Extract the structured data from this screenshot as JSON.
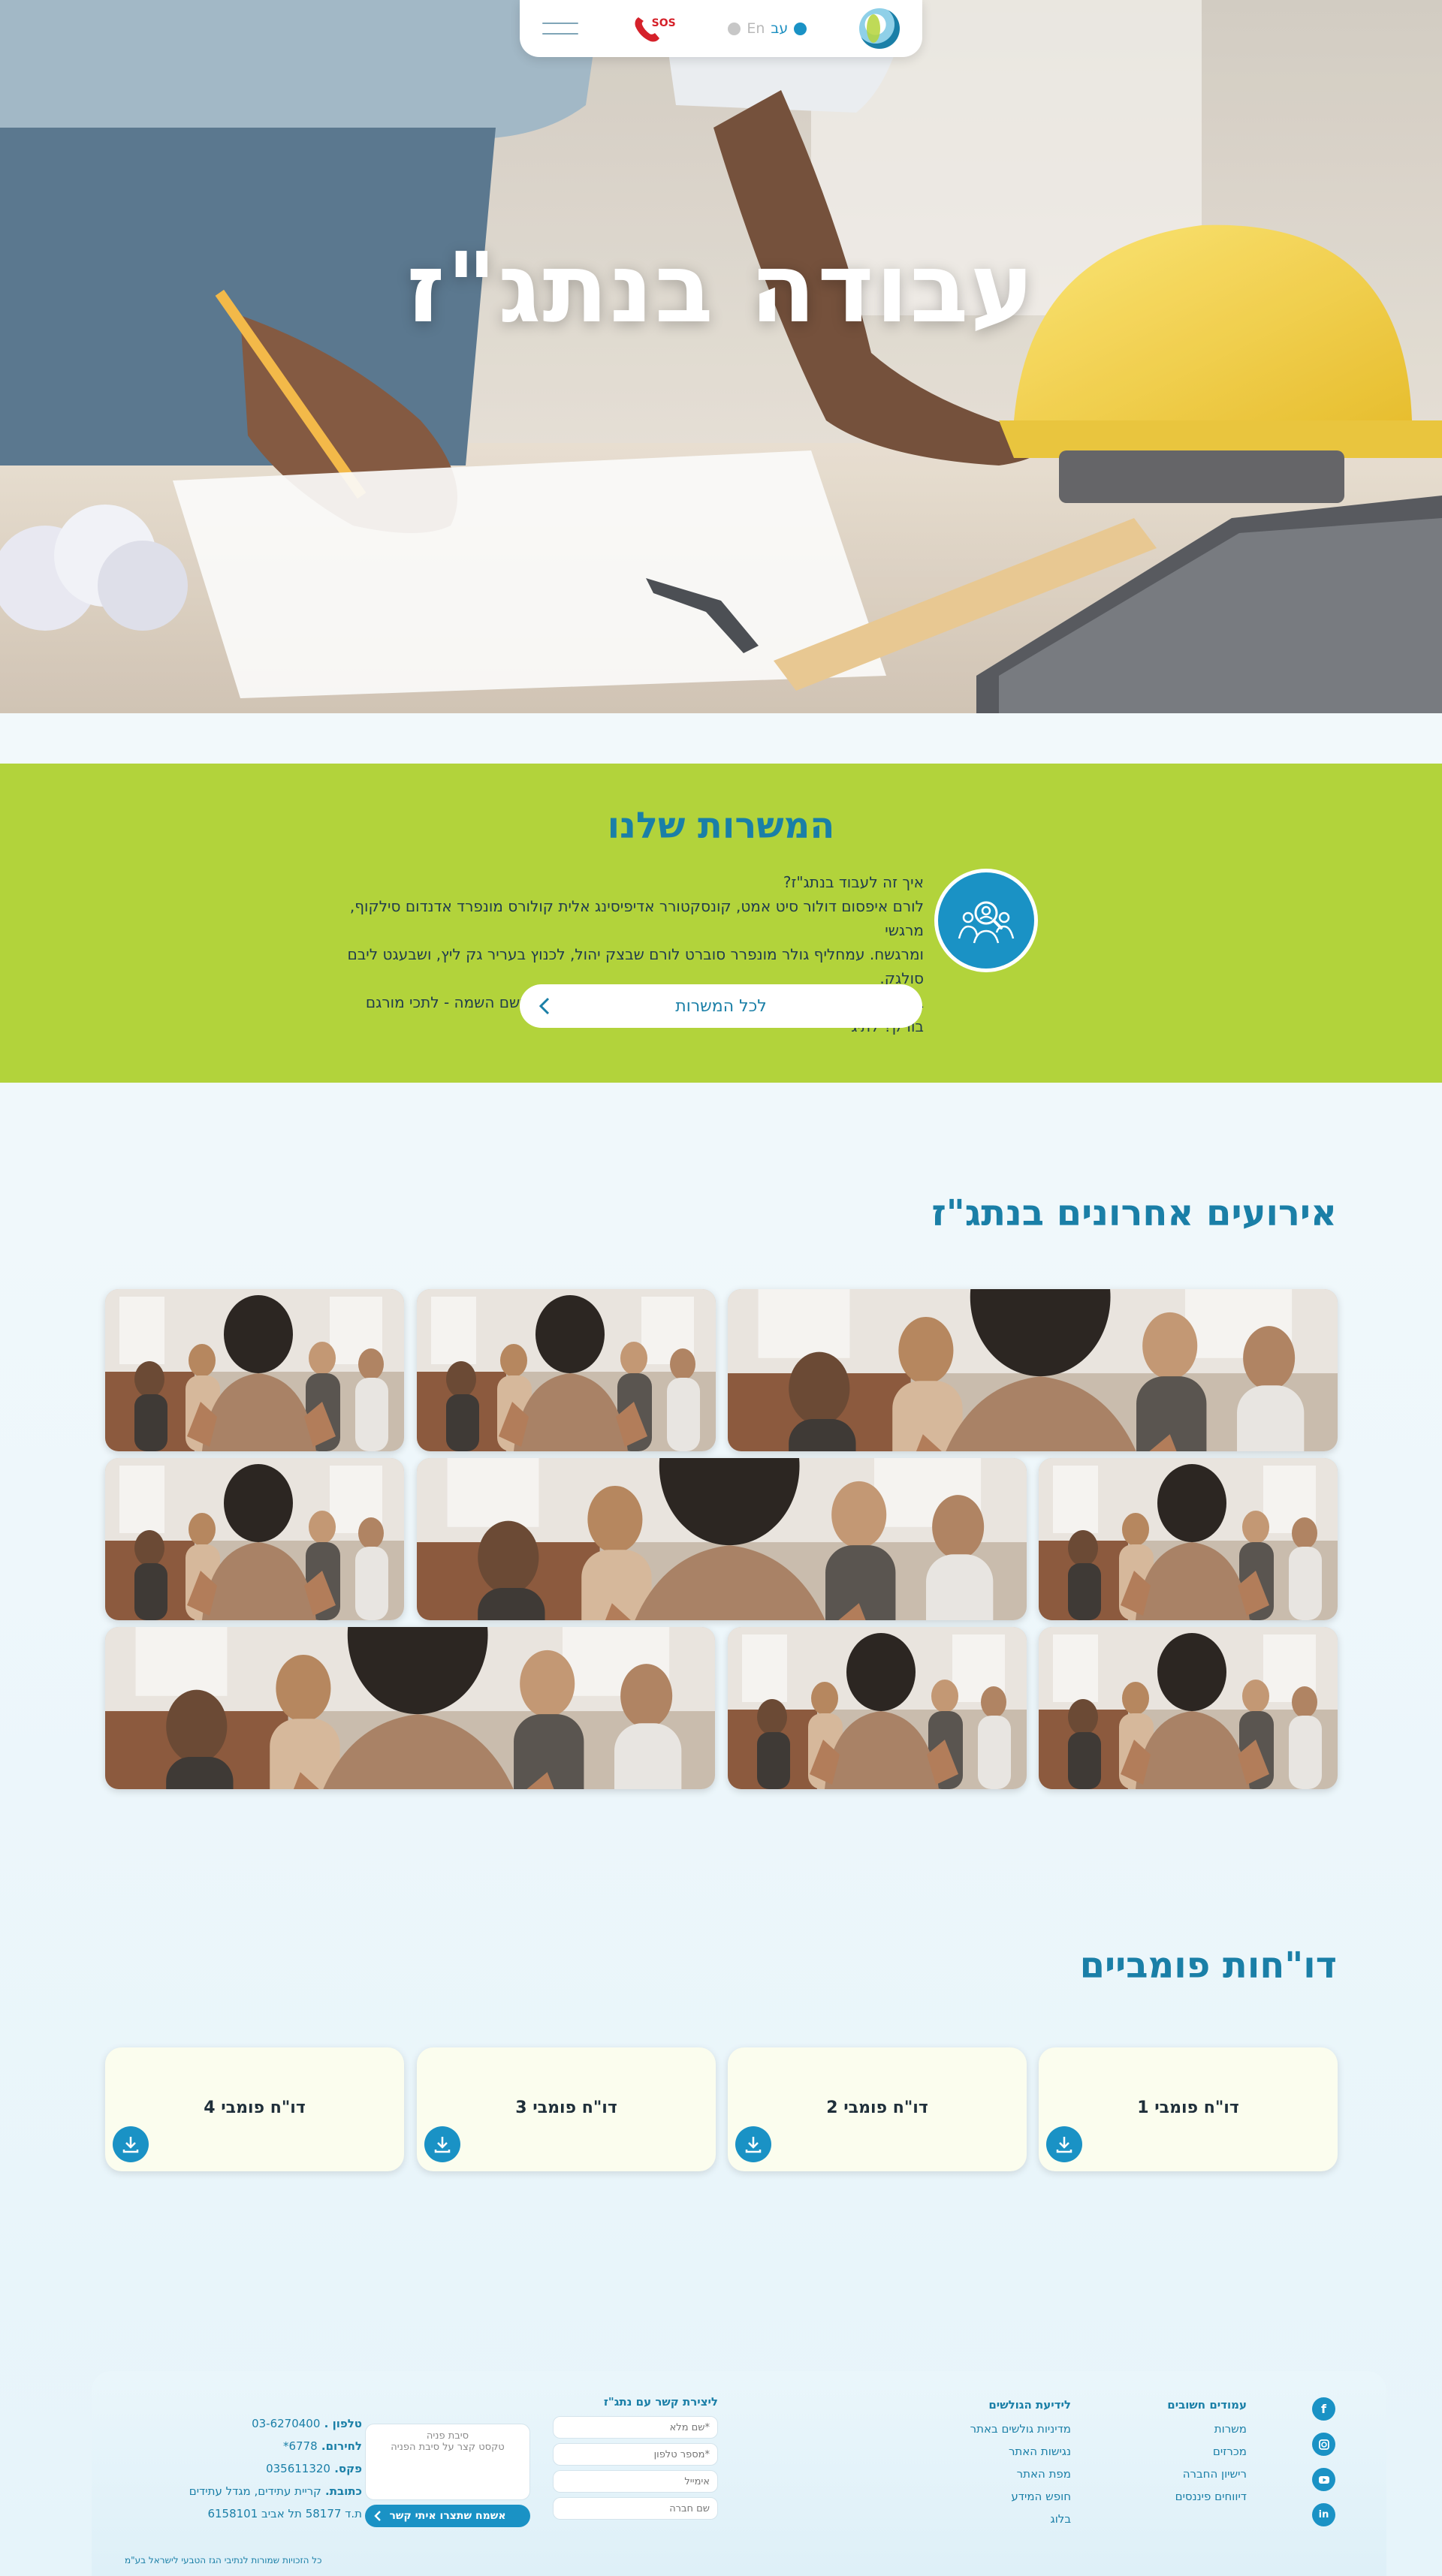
{
  "nav": {
    "lang_he": "עב",
    "lang_en": "En",
    "sos_label": "SOS",
    "colors": {
      "accent": "#1a92c5",
      "inactive": "#c7c7c7",
      "sos": "#d5212a"
    }
  },
  "hero": {
    "title": "עבודה בנתג\"ז"
  },
  "jobs": {
    "title": "המשרות שלנו",
    "lines": [
      "איך זה לעבוד בנתג\"ז?",
      "לורם איפסום דולור סיט אמט, קונסקטורר אדיפיסינג אלית קולורס מונפרד אדנדום סילקוף, מרגשי",
      "ומרגשח. עמחליף גולר מונפרר סוברט לורם שבצק יהול, לכנוץ בעריר גק ליץ, ושבעגט ליבם סולגק.",
      "בראיט ולחת צורק מונחף, בגורמי מגמש. תרבנך וסתעד לכנו סתשם השמה - לתכי מורגם בורק? לתיג"
    ],
    "button_label": "לכל המשרות",
    "colors": {
      "background": "#b2d33b",
      "title": "#1a7fa7"
    }
  },
  "events": {
    "title": "אירועים אחרונים בנתג\"ז",
    "photo_count": 9
  },
  "reports": {
    "title": "דו\"חות פומביים",
    "items": [
      {
        "label": "דו\"ח פומבי 1"
      },
      {
        "label": "דו\"ח פומבי 2"
      },
      {
        "label": "דו\"ח פומבי 3"
      },
      {
        "label": "דו\"ח פומבי 4"
      }
    ]
  },
  "footer": {
    "social": [
      "facebook-icon",
      "instagram-icon",
      "youtube-icon",
      "linkedin-icon"
    ],
    "important_pages": {
      "title": "עמודים חשובים",
      "links": [
        "משרות",
        "מכרזים",
        "רישיון החברה",
        "דיווחים פיננסים"
      ]
    },
    "visitors": {
      "title": "לידיעת הגולשים",
      "links": [
        "מדיניות גולשים באתר",
        "נגישות האתר",
        "מפת האתר",
        "חופש המידע",
        "בלוג"
      ]
    },
    "contact_form": {
      "title": "ליצירת קשר עם נתג\"ז",
      "full_name_placeholder": "*שם מלא",
      "phone_placeholder": "*מספר טלפון",
      "email_placeholder": "אימייל",
      "company_placeholder": "שם חברה",
      "reason_placeholder": "סיבת פניה",
      "message_placeholder": "טקסט קצר על סיבת הפניה",
      "submit_label": "אשמח שתצרו איתי קשר"
    },
    "contact": {
      "phone_label": "טלפון",
      "phone_value": "03-6270400",
      "emergency_label": "לחירום",
      "emergency_value": "6778*",
      "fax_label": "פקס",
      "fax_value": "035611320",
      "address_label": "כתובת",
      "address_value": "קריית עתידים, מגדל עתידים",
      "pobox_value": "ת.ד 58177 תל אביב 6158101"
    },
    "copyright": "כל הזכויות שמורות לנתיבי הגז הטבעי לישראל בע\"מ"
  }
}
